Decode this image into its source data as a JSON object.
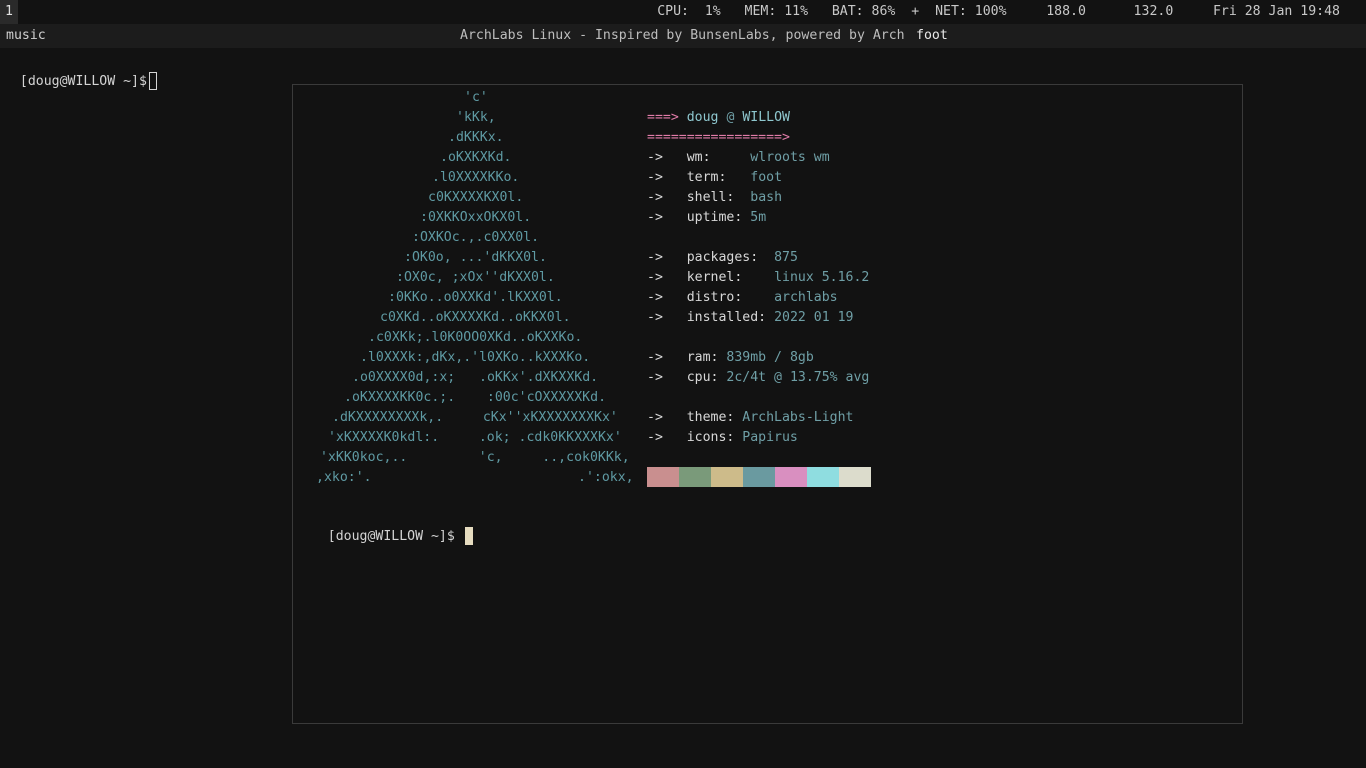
{
  "topbar": {
    "workspace": "1",
    "status": "CPU:  1%   MEM: 11%   BAT: 86%  +  NET: 100%     188.0      132.0     Fri 28 Jan 19:48"
  },
  "titlebar": {
    "left": "music",
    "center": "ArchLabs Linux - Inspired by BunsenLabs, powered by Arch",
    "right": "foot"
  },
  "bg_terminal": {
    "prompt": "[doug@WILLOW ~]$"
  },
  "fetch": {
    "header_arrow": "===>",
    "user": "doug",
    "at": "@",
    "host": "WILLOW",
    "rule": "=================>",
    "arrow": "->",
    "rows": [
      {
        "key": "wm:",
        "value": "wlroots wm"
      },
      {
        "key": "term:",
        "value": "foot"
      },
      {
        "key": "shell:",
        "value": "bash"
      },
      {
        "key": "uptime:",
        "value": "5m"
      },
      {
        "key": "packages:",
        "value": "875"
      },
      {
        "key": "kernel:",
        "value": "linux 5.16.2"
      },
      {
        "key": "distro:",
        "value": "archlabs"
      },
      {
        "key": "installed:",
        "value": "2022 01 19"
      },
      {
        "key": "ram:",
        "value": "839mb / 8gb"
      },
      {
        "key": "cpu:",
        "value": "2c/4t @ 13.75% avg"
      },
      {
        "key": "theme:",
        "value": "ArchLabs-Light"
      },
      {
        "key": "icons:",
        "value": "Papirus"
      }
    ],
    "swatch_colors": [
      "#c98f8f",
      "#7a9a7a",
      "#cdbb8a",
      "#6a9aa0",
      "#d98fc0",
      "#8fdde0",
      "#dcdccc"
    ]
  },
  "art": [
    "'c'",
    "'kKk,",
    ".dKKKx.",
    ".oKXKXKd.",
    ".l0XXXXKKo.",
    "c0KXXXXKX0l.",
    ":0XKKOxxOKX0l.",
    ":OXKOc.,.c0XX0l.",
    ":OK0o, ...'dKKX0l.",
    ":OX0c, ;xOx''dKXX0l.",
    ":0KKo..o0XXKd'.lKXX0l.",
    "c0XKd..oKXXXXKd..oKKX0l.",
    ".c0XKk;.l0K0OO0XKd..oKXXKo.",
    ".l0XXXk:,dKx,.'l0XKo..kXXXKo.",
    ".o0XXXX0d,:x;   .oKKx'.dXKXXKd.",
    ".oKXXXXKK0c.;.    :00c'cOXXXXXKd.",
    ".dKXXXXXXXXk,.     cKx''xKXXXXXXXKx'",
    "'xKXXXXK0kdl:.     .ok; .cdk0KKXXXKx'",
    "'xKK0koc,..         'c,     ..,cok0KKk,",
    ",xko:'.                          .':okx,"
  ],
  "fg_terminal": {
    "prompt": "[doug@WILLOW ~]$"
  }
}
